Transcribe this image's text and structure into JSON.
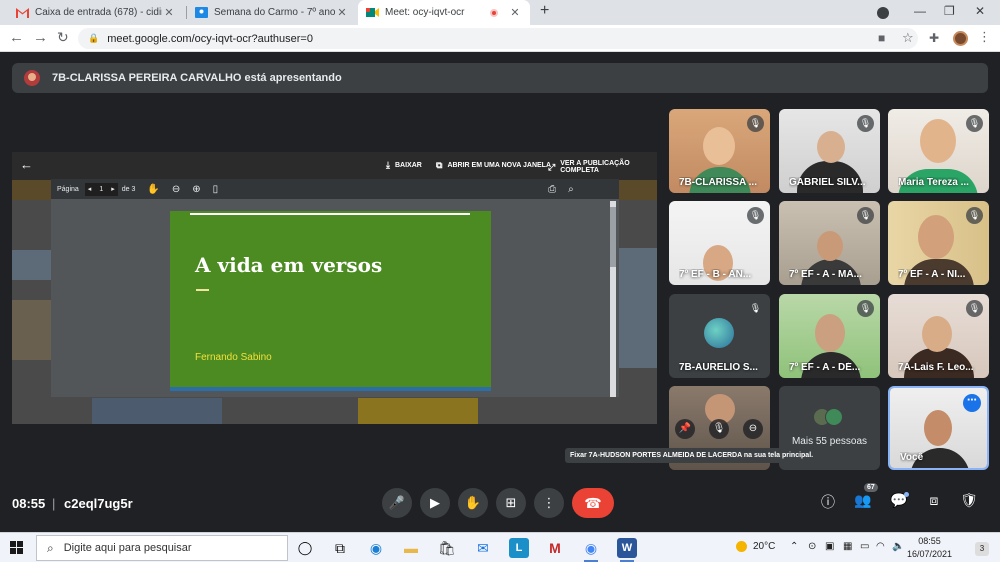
{
  "browser": {
    "tabs": [
      {
        "title": "Caixa de entrada (678) - cidinha(",
        "active": false
      },
      {
        "title": "Semana do Carmo - 7º ano EF A",
        "active": false
      },
      {
        "title": "Meet: ocy-iqvt-ocr",
        "active": true
      }
    ],
    "url": "meet.google.com/ocy-iqvt-ocr?authuser=0"
  },
  "meet": {
    "presenter_banner": "7B-CLARISSA PEREIRA CARVALHO está apresentando",
    "drive": {
      "download": "BAIXAR",
      "open_new": "ABRIR EM UMA NOVA JANELA",
      "view_pub": "VER A PUBLICAÇÃO COMPLETA"
    },
    "pdf": {
      "page_label": "Página",
      "page_num": "1",
      "page_of": "de 3"
    },
    "slide": {
      "title": "A vida em versos",
      "author": "Fernando Sabino"
    },
    "participants": [
      {
        "name": "7B-CLARISSA ..."
      },
      {
        "name": "GABRIEL SILV..."
      },
      {
        "name": "Maria Tereza ..."
      },
      {
        "name": "7º EF - B - AN..."
      },
      {
        "name": "7º EF - A - MA..."
      },
      {
        "name": "7º EF - A - NI..."
      },
      {
        "name": "7B-AURELIO S..."
      },
      {
        "name": "7º EF - A - DÉ..."
      },
      {
        "name": "7A-Lais F. Leo..."
      }
    ],
    "more_people": "Mais 55 pessoas",
    "self_name": "Você",
    "pin_tooltip": "Fixar 7A-HUDSON PORTES ALMEIDA DE LACERDA na sua tela principal.",
    "clock": "08:55",
    "meeting_code": "c2eql7ug5r",
    "people_count": "67"
  },
  "taskbar": {
    "search_placeholder": "Digite aqui para pesquisar",
    "temperature": "20°C",
    "time": "08:55",
    "date": "16/07/2021",
    "notifications": "3"
  }
}
